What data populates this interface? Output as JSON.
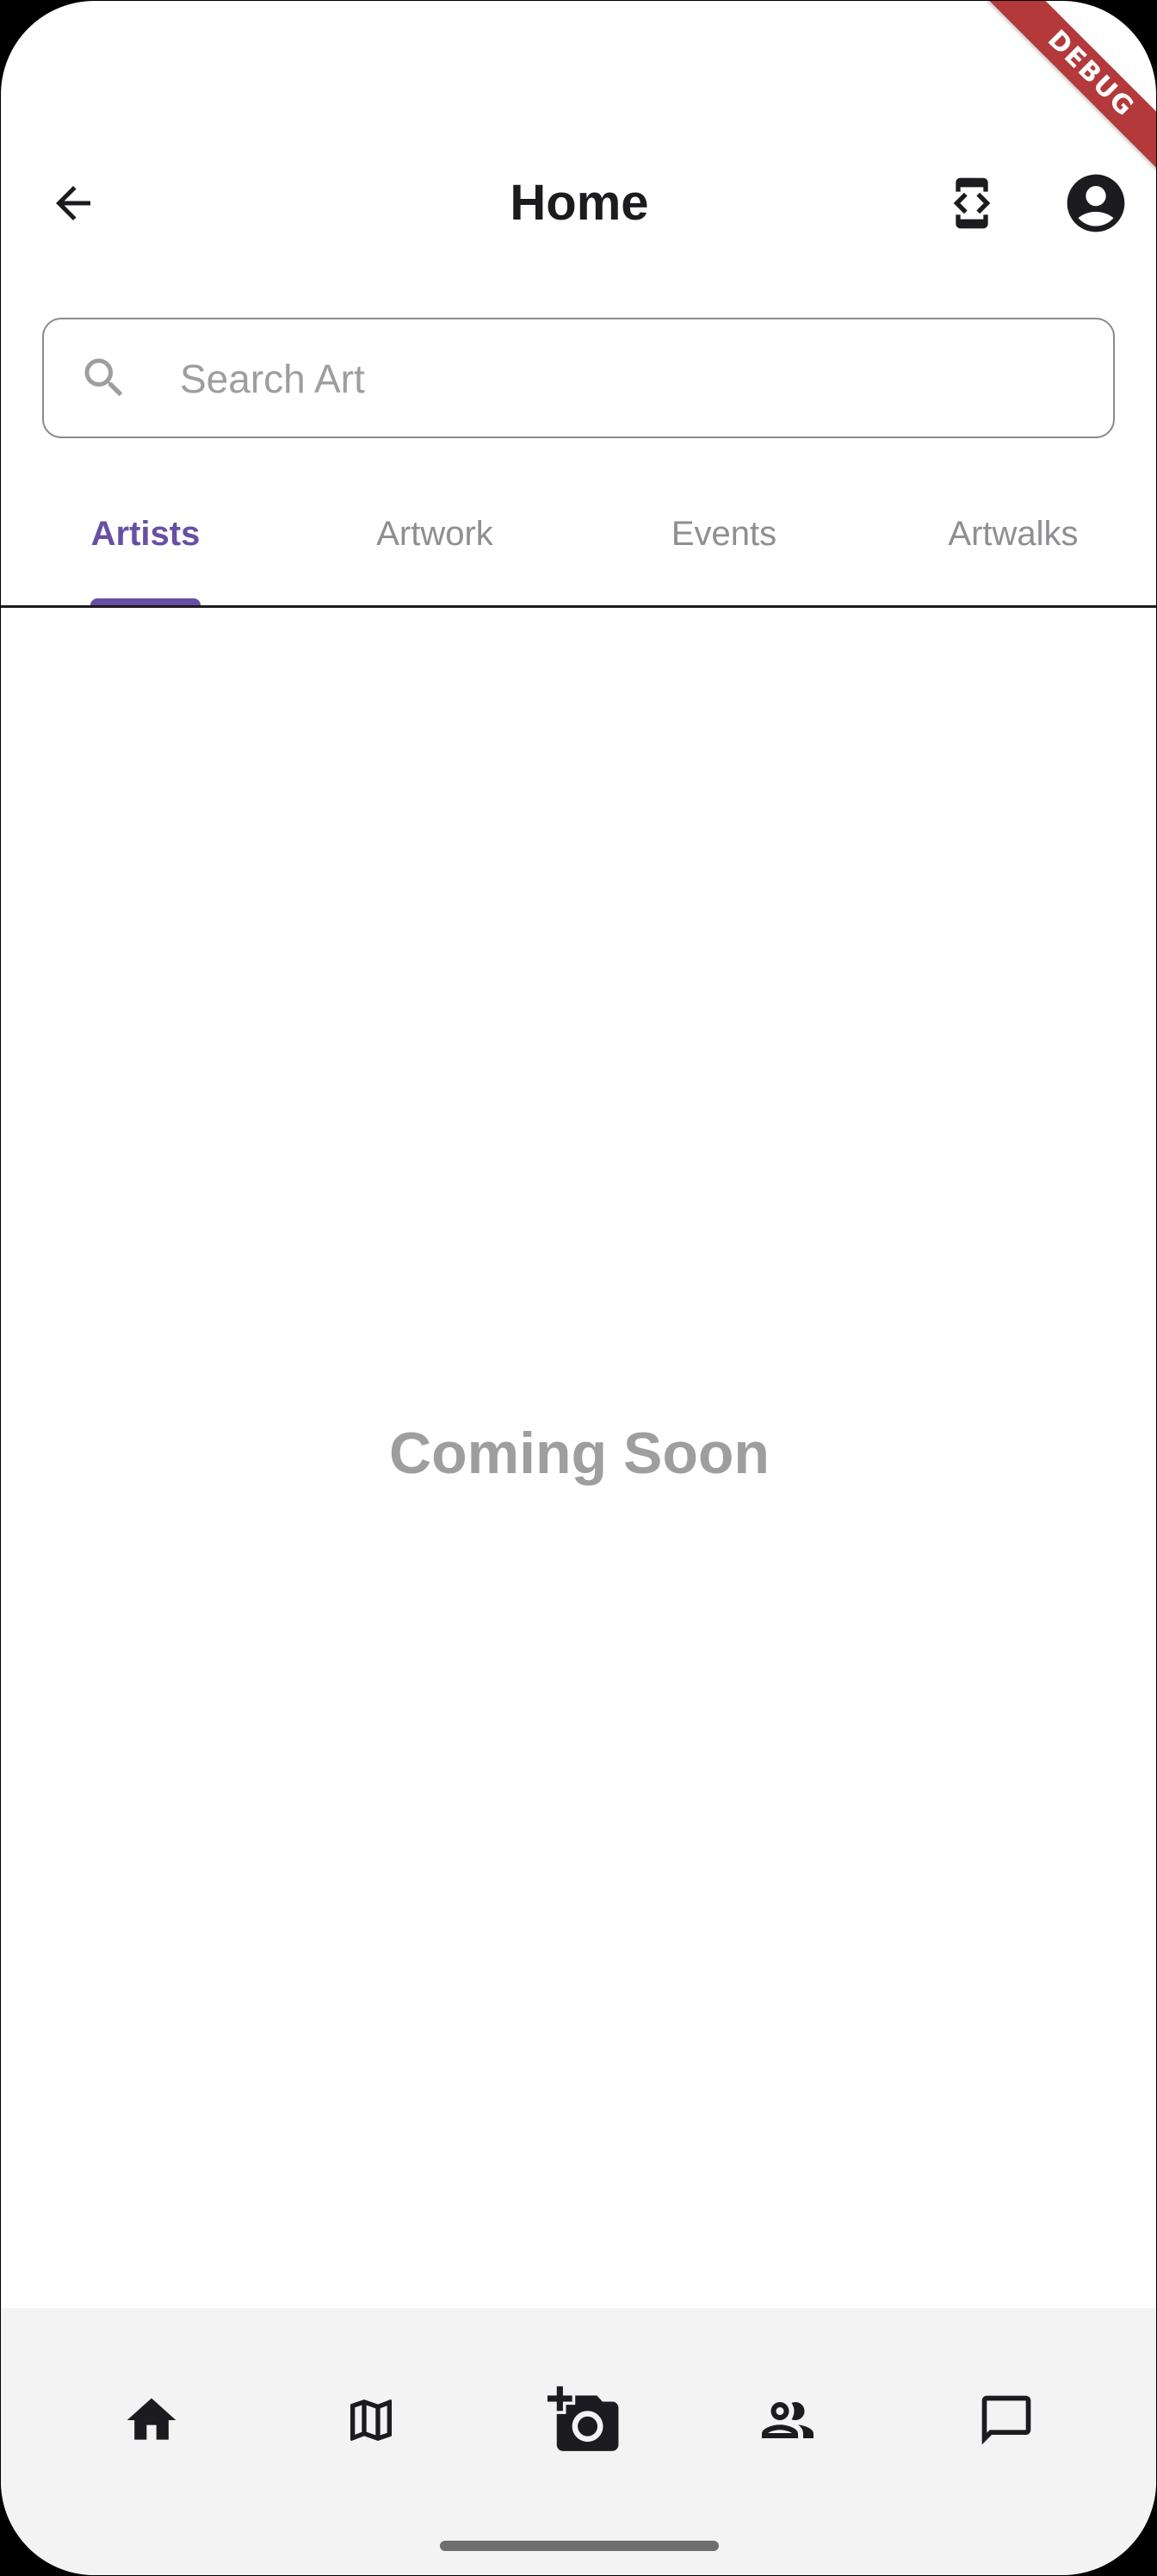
{
  "banner": {
    "label": "DEBUG"
  },
  "appbar": {
    "title": "Home",
    "back_icon": "arrow-back-icon",
    "developer_icon": "developer-mode-icon",
    "profile_icon": "account-circle-icon"
  },
  "search": {
    "placeholder": "Search Art",
    "value": "",
    "icon": "search-icon"
  },
  "tabs": [
    {
      "label": "Artists",
      "active": true
    },
    {
      "label": "Artwork",
      "active": false
    },
    {
      "label": "Events",
      "active": false
    },
    {
      "label": "Artwalks",
      "active": false
    }
  ],
  "content": {
    "message": "Coming Soon"
  },
  "bottom_nav": {
    "items": [
      {
        "icon": "home-icon",
        "active": true
      },
      {
        "icon": "map-icon",
        "active": false
      },
      {
        "icon": "add-a-photo-icon",
        "active": false
      },
      {
        "icon": "people-icon",
        "active": false
      },
      {
        "icon": "chat-icon",
        "active": false
      }
    ]
  },
  "colors": {
    "accent": "#6750a4",
    "debug_banner": "#b3393a",
    "muted_text": "#9e9e9e",
    "nav_background": "#f3f3f3"
  }
}
